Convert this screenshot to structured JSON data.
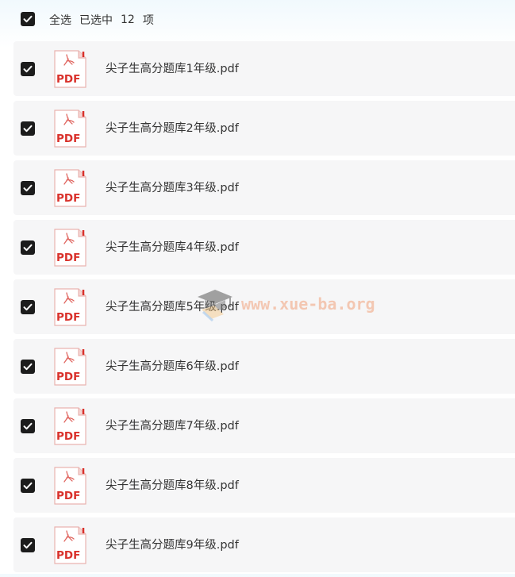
{
  "header": {
    "select_all_label": "全选",
    "selected_prefix": "已选中",
    "selected_count": "12",
    "selected_suffix": "项",
    "select_all_checked": true
  },
  "icon_badge_text": "PDF",
  "watermark": {
    "text": "www.xue-ba.org",
    "icon": "graduation-cap-icon"
  },
  "files": [
    {
      "name": "尖子生高分题库1年级.pdf",
      "checked": true
    },
    {
      "name": "尖子生高分题库2年级.pdf",
      "checked": true
    },
    {
      "name": "尖子生高分题库3年级.pdf",
      "checked": true
    },
    {
      "name": "尖子生高分题库4年级.pdf",
      "checked": true
    },
    {
      "name": "尖子生高分题库5年级.pdf",
      "checked": true
    },
    {
      "name": "尖子生高分题库6年级.pdf",
      "checked": true
    },
    {
      "name": "尖子生高分题库7年级.pdf",
      "checked": true
    },
    {
      "name": "尖子生高分题库8年级.pdf",
      "checked": true
    },
    {
      "name": "尖子生高分题库9年级.pdf",
      "checked": true
    }
  ],
  "colors": {
    "checkbox": "#1c1c1c",
    "row_background": "#f6f6f7",
    "pdf_red": "#d9312b",
    "watermark": "#f2a27b"
  }
}
